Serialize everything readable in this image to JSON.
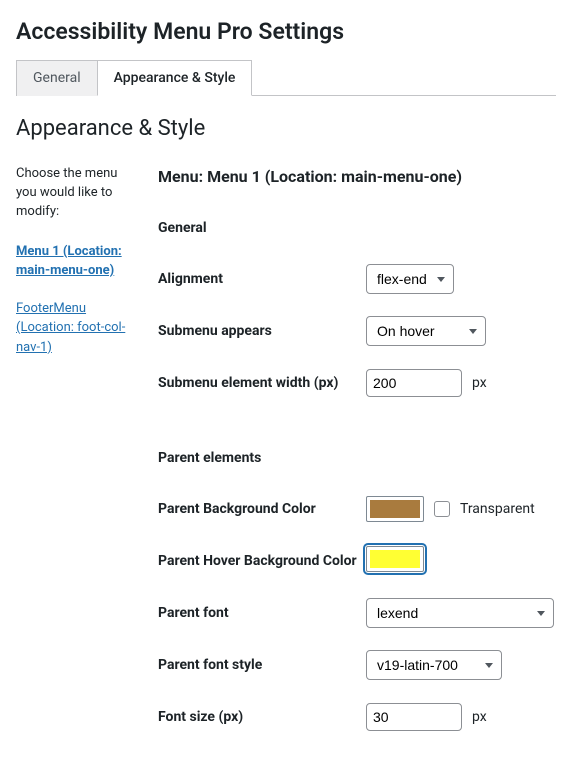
{
  "page_title": "Accessibility Menu Pro Settings",
  "tabs": {
    "general": "General",
    "appearance": "Appearance & Style"
  },
  "subheading": "Appearance & Style",
  "sidebar": {
    "intro": "Choose the menu you would like to modify:",
    "menus": [
      "Menu 1 (Location: main-menu-one)",
      "FooterMenu (Location: foot-col-nav-1)"
    ]
  },
  "main": {
    "menu_title": "Menu: Menu 1 (Location: main-menu-one)",
    "sections": {
      "general": {
        "heading": "General",
        "alignment": {
          "label": "Alignment",
          "value": "flex-end"
        },
        "submenu": {
          "label": "Submenu appears",
          "value": "On hover"
        },
        "submenu_w": {
          "label": "Submenu element width (px)",
          "value": "200",
          "unit": "px"
        }
      },
      "parent": {
        "heading": "Parent elements",
        "bg": {
          "label": "Parent Background Color",
          "color": "#a97b3e",
          "transparent_label": "Transparent",
          "transparent_checked": false
        },
        "hover_bg": {
          "label": "Parent Hover Background Color",
          "color": "#ffff33"
        },
        "font": {
          "label": "Parent font",
          "value": "lexend"
        },
        "style": {
          "label": "Parent font style",
          "value": "v19-latin-700"
        },
        "size": {
          "label": "Font size (px)",
          "value": "30",
          "unit": "px"
        }
      }
    }
  }
}
